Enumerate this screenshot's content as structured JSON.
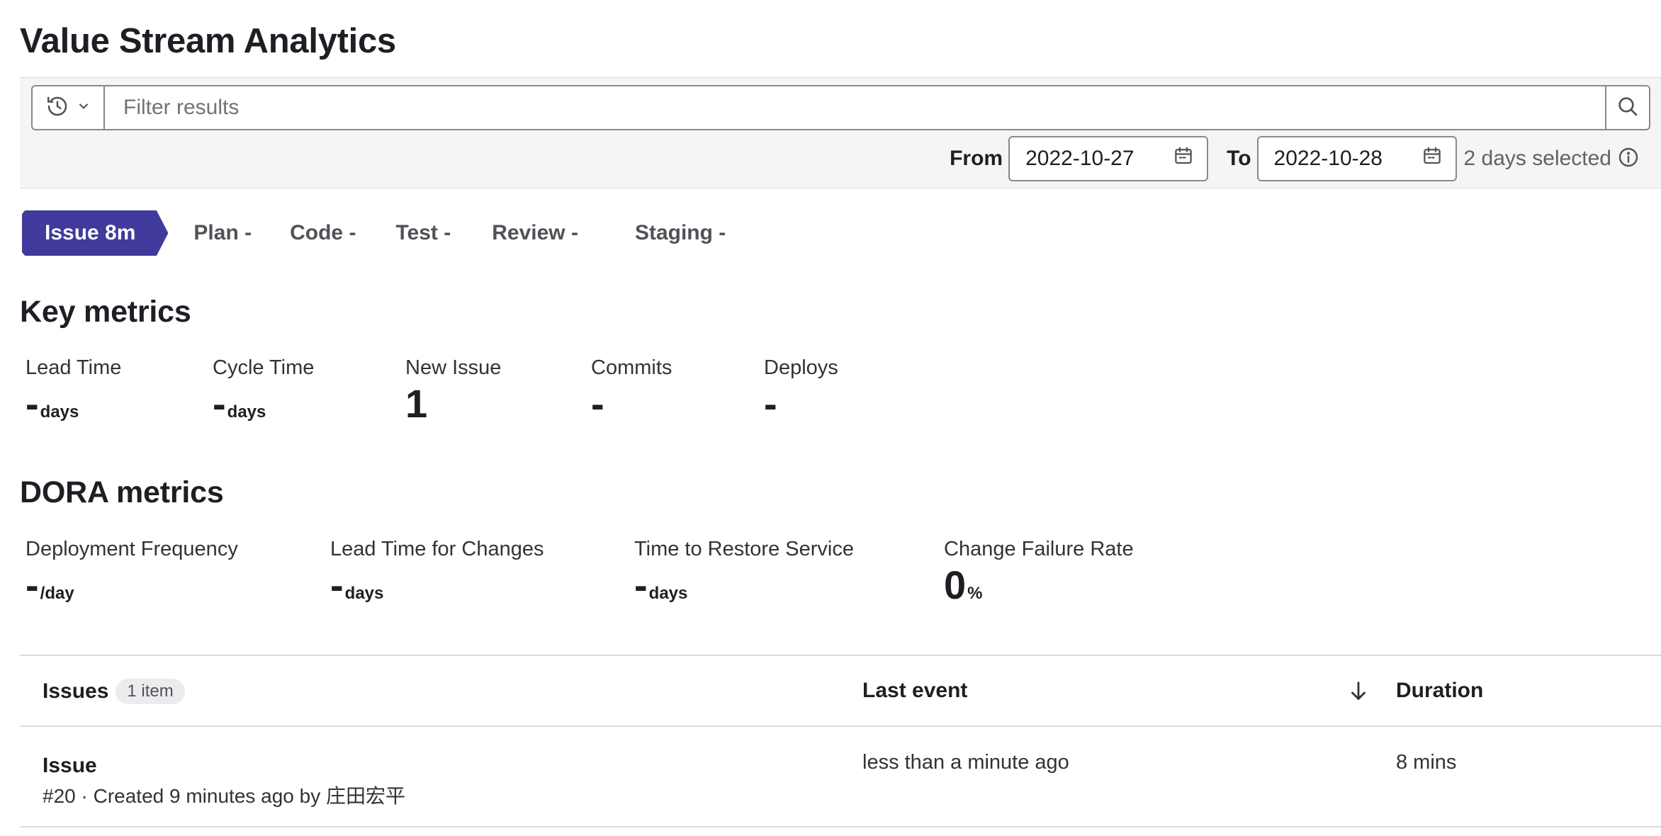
{
  "page": {
    "title": "Value Stream Analytics"
  },
  "filter": {
    "placeholder": "Filter results",
    "from_label": "From",
    "from_value": "2022-10-27",
    "to_label": "To",
    "to_value": "2022-10-28",
    "days_selected": "2 days selected"
  },
  "stages": [
    {
      "name": "Issue",
      "value": "8m",
      "active": true
    },
    {
      "name": "Plan",
      "value": "-"
    },
    {
      "name": "Code",
      "value": "-"
    },
    {
      "name": "Test",
      "value": "-"
    },
    {
      "name": "Review",
      "value": "-"
    },
    {
      "name": "Staging",
      "value": "-"
    }
  ],
  "stage_labels": {
    "issue": "Issue 8m",
    "plan": "Plan -",
    "code": "Code -",
    "test": "Test -",
    "review": "Review -",
    "staging": "Staging -"
  },
  "key_metrics": {
    "title": "Key metrics",
    "lead_time": {
      "label": "Lead Time",
      "value": "-",
      "unit": "days"
    },
    "cycle_time": {
      "label": "Cycle Time",
      "value": "-",
      "unit": "days"
    },
    "new_issue": {
      "label": "New Issue",
      "value": "1"
    },
    "commits": {
      "label": "Commits",
      "value": "-"
    },
    "deploys": {
      "label": "Deploys",
      "value": "-"
    }
  },
  "dora_metrics": {
    "title": "DORA metrics",
    "deployment_frequency": {
      "label": "Deployment Frequency",
      "value": "-",
      "unit": "/day"
    },
    "lead_time_for_changes": {
      "label": "Lead Time for Changes",
      "value": "-",
      "unit": "days"
    },
    "time_to_restore": {
      "label": "Time to Restore Service",
      "value": "-",
      "unit": "days"
    },
    "change_failure_rate": {
      "label": "Change Failure Rate",
      "value": "0",
      "unit": "%"
    }
  },
  "table": {
    "col_issues": "Issues",
    "count_badge": "1 item",
    "col_last_event": "Last event",
    "col_duration": "Duration",
    "rows": [
      {
        "title": "Issue",
        "meta": "#20 · Created 9 minutes ago by 庄田宏平",
        "last_event": "less than a minute ago",
        "duration": "8 mins"
      }
    ]
  },
  "colors": {
    "accent": "#3f3a9b",
    "border": "#89888d",
    "muted_bg": "#f5f5f6"
  }
}
